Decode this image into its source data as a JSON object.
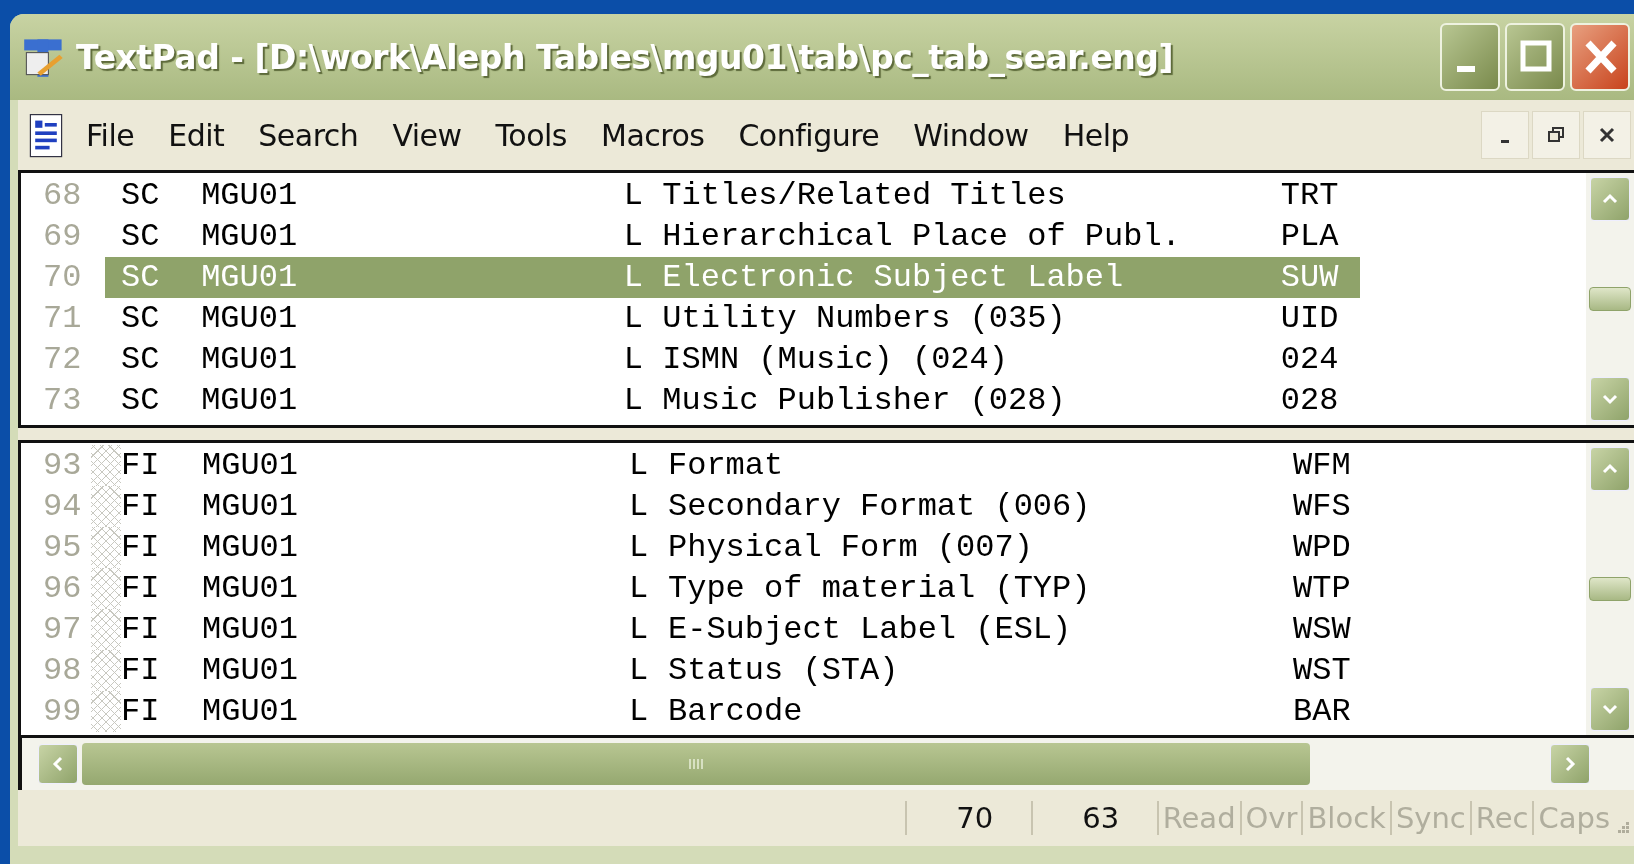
{
  "window": {
    "title": "TextPad - [D:\\work\\Aleph Tables\\mgu01\\tab\\pc_tab_sear.eng]"
  },
  "menu": [
    "File",
    "Edit",
    "Search",
    "View",
    "Tools",
    "Macros",
    "Configure",
    "Window",
    "Help"
  ],
  "upper_pane": {
    "rows": [
      {
        "line": "68",
        "type": "SC",
        "library": "MGU01",
        "flag": "L",
        "label": "Titles/Related Titles",
        "code": "TRT",
        "selected": false,
        "marked": false
      },
      {
        "line": "69",
        "type": "SC",
        "library": "MGU01",
        "flag": "L",
        "label": "Hierarchical Place of Publ.",
        "code": "PLA",
        "selected": false,
        "marked": false
      },
      {
        "line": "70",
        "type": "SC",
        "library": "MGU01",
        "flag": "L",
        "label": "Electronic Subject Label",
        "code": "SUW",
        "selected": true,
        "marked": false
      },
      {
        "line": "71",
        "type": "SC",
        "library": "MGU01",
        "flag": "L",
        "label": "Utility Numbers (035)",
        "code": "UID",
        "selected": false,
        "marked": false
      },
      {
        "line": "72",
        "type": "SC",
        "library": "MGU01",
        "flag": "L",
        "label": "ISMN (Music) (024)",
        "code": "024",
        "selected": false,
        "marked": false
      },
      {
        "line": "73",
        "type": "SC",
        "library": "MGU01",
        "flag": "L",
        "label": "Music Publisher (028)",
        "code": "028",
        "selected": false,
        "marked": false
      }
    ]
  },
  "lower_pane": {
    "rows": [
      {
        "line": "93",
        "type": "FI",
        "library": "MGU01",
        "flag": "L",
        "label": "Format",
        "code": "WFM",
        "selected": false,
        "marked": true
      },
      {
        "line": "94",
        "type": "FI",
        "library": "MGU01",
        "flag": "L",
        "label": "Secondary Format (006)",
        "code": "WFS",
        "selected": false,
        "marked": true
      },
      {
        "line": "95",
        "type": "FI",
        "library": "MGU01",
        "flag": "L",
        "label": "Physical Form (007)",
        "code": "WPD",
        "selected": false,
        "marked": true
      },
      {
        "line": "96",
        "type": "FI",
        "library": "MGU01",
        "flag": "L",
        "label": "Type of material (TYP)",
        "code": "WTP",
        "selected": false,
        "marked": true
      },
      {
        "line": "97",
        "type": "FI",
        "library": "MGU01",
        "flag": "L",
        "label": "E-Subject Label (ESL)",
        "code": "WSW",
        "selected": false,
        "marked": true
      },
      {
        "line": "98",
        "type": "FI",
        "library": "MGU01",
        "flag": "L",
        "label": "Status (STA)",
        "code": "WST",
        "selected": false,
        "marked": true
      },
      {
        "line": "99",
        "type": "FI",
        "library": "MGU01",
        "flag": "L",
        "label": "Barcode",
        "code": "BAR",
        "selected": false,
        "marked": true
      }
    ]
  },
  "status_bar": {
    "line": "70",
    "column": "63",
    "indicators": [
      {
        "label": "Read",
        "on": false
      },
      {
        "label": "Ovr",
        "on": false
      },
      {
        "label": "Block",
        "on": false
      },
      {
        "label": "Sync",
        "on": false
      },
      {
        "label": "Rec",
        "on": false
      },
      {
        "label": "Caps",
        "on": false
      }
    ]
  }
}
